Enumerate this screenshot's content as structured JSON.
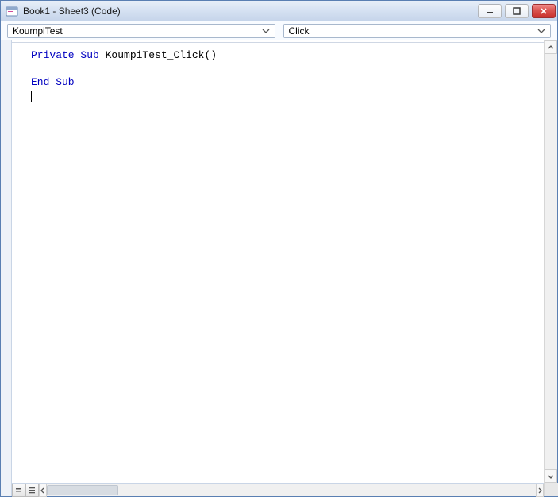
{
  "window": {
    "title": "Book1 - Sheet3 (Code)"
  },
  "dropdowns": {
    "object": "KoumpiTest",
    "procedure": "Click"
  },
  "code": {
    "line1_kw1": "Private",
    "line1_kw2": "Sub",
    "line1_ident": " KoumpiTest_Click()",
    "line2_kw": "End Sub"
  }
}
